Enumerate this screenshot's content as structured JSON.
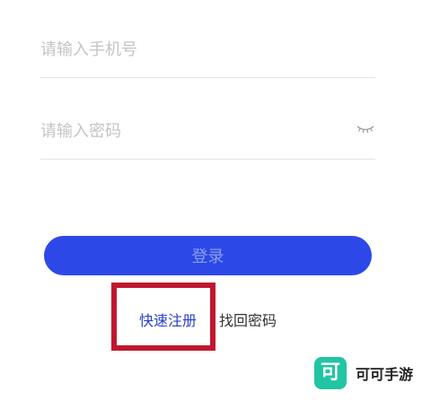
{
  "form": {
    "phone": {
      "placeholder": "请输入手机号",
      "value": ""
    },
    "password": {
      "placeholder": "请输入密码",
      "value": "",
      "visibility_icon": "eye-closed-icon"
    },
    "login_button_label": "登录"
  },
  "links": {
    "register": "快速注册",
    "forgot_password": "找回密码"
  },
  "watermark": {
    "logo_char": "可",
    "text": "可可手游"
  },
  "colors": {
    "primary": "#2c49e8",
    "link": "#2941c9",
    "highlight": "#c01730",
    "watermark": "#22c4a4"
  }
}
